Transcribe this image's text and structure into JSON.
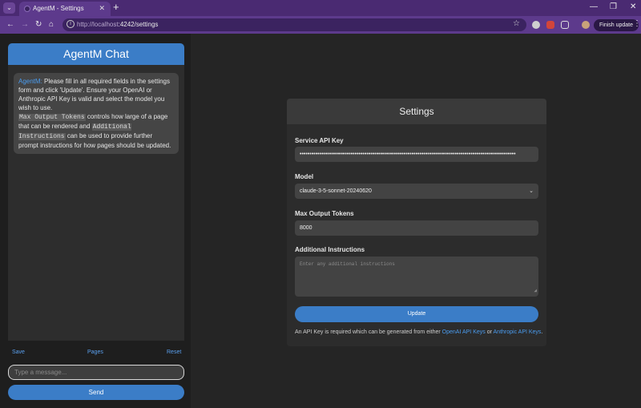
{
  "browser": {
    "tab_title": "AgentM - Settings",
    "url_host": "http://localhost",
    "url_rest": ":4242/settings",
    "finish_update": "Finish update"
  },
  "chat": {
    "title": "AgentM Chat",
    "agent_name": "AgentM:",
    "message_part1": "Please fill in all required fields in the settings form and click 'Update'. Ensure your OpenAI or Anthropic API Key is valid and select the model you wish to use.",
    "code_max_tokens": "Max Output Tokens",
    "message_part2": "controls how large of a page that can be rendered and",
    "code_additional": "Additional Instructions",
    "message_part3": "can be used to provide further prompt instructions for how pages should be updated.",
    "links": {
      "save": "Save",
      "pages": "Pages",
      "reset": "Reset"
    },
    "input_placeholder": "Type a message...",
    "send_label": "Send"
  },
  "settings": {
    "title": "Settings",
    "api_key_label": "Service API Key",
    "api_key_value": "••••••••••••••••••••••••••••••••••••••••••••••••••••••••••••••••••••••••••••••••••••••••••••••••••••••••••••••",
    "model_label": "Model",
    "model_value": "claude-3-5-sonnet-20240620",
    "max_tokens_label": "Max Output Tokens",
    "max_tokens_value": "8000",
    "instructions_label": "Additional Instructions",
    "instructions_placeholder": "Enter any additional instructions",
    "update_label": "Update",
    "note_prefix": "An API Key is required which can be generated from either",
    "openai_link": "OpenAI API Keys",
    "note_or": "or",
    "anthropic_link": "Anthropic API Keys",
    "note_suffix": "."
  }
}
